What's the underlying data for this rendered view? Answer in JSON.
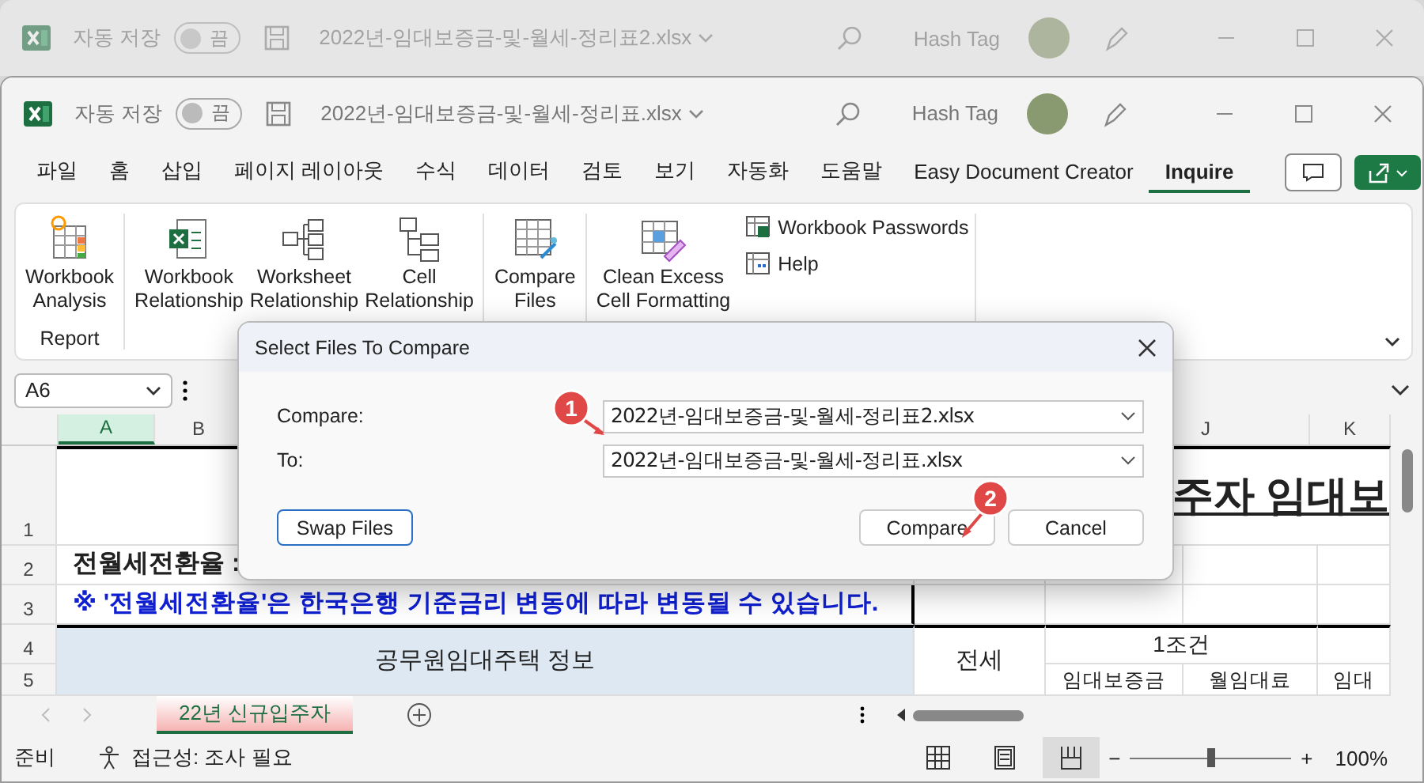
{
  "background_window": {
    "title": "2022년-임대보증금-및-월세-정리표2.xlsx",
    "autosave": {
      "label": "자동 저장",
      "state_text": "끔",
      "on": false
    },
    "user": "Hash Tag"
  },
  "window": {
    "title": "2022년-임대보증금-및-월세-정리표.xlsx",
    "autosave": {
      "label": "자동 저장",
      "state_text": "끔",
      "on": false
    },
    "user": "Hash Tag"
  },
  "menu_tabs": [
    {
      "label": "파일",
      "selected": false
    },
    {
      "label": "홈",
      "selected": false
    },
    {
      "label": "삽입",
      "selected": false
    },
    {
      "label": "페이지 레이아웃",
      "selected": false
    },
    {
      "label": "수식",
      "selected": false
    },
    {
      "label": "데이터",
      "selected": false
    },
    {
      "label": "검토",
      "selected": false
    },
    {
      "label": "보기",
      "selected": false
    },
    {
      "label": "자동화",
      "selected": false
    },
    {
      "label": "도움말",
      "selected": false
    },
    {
      "label": "Easy Document Creator",
      "selected": false
    },
    {
      "label": "Inquire",
      "selected": true
    }
  ],
  "ribbon": {
    "groups": [
      {
        "label": "Report",
        "buttons": [
          {
            "kind": "analysis",
            "label": "Workbook\nAnalysis"
          }
        ]
      },
      {
        "buttons": [
          {
            "kind": "workbook",
            "label": "Workbook\nRelationship"
          },
          {
            "kind": "worksheet",
            "label": "Worksheet\nRelationship"
          },
          {
            "kind": "cell",
            "label": "Cell\nRelationship"
          }
        ]
      },
      {
        "buttons": [
          {
            "kind": "compare",
            "label": "Compare\nFiles"
          }
        ]
      },
      {
        "buttons": [
          {
            "kind": "clean",
            "label": "Clean Excess\nCell Formatting"
          }
        ],
        "small_buttons": [
          {
            "kind": "passwords",
            "label": "Workbook Passwords"
          },
          {
            "kind": "help",
            "label": "Help"
          }
        ]
      }
    ]
  },
  "name_box": {
    "value": "A6"
  },
  "column_headers": [
    {
      "label": "A",
      "selected": true
    },
    {
      "label": "B",
      "selected": false
    },
    {
      "label": "J",
      "selected": false
    },
    {
      "label": "K",
      "selected": false
    }
  ],
  "row_headers": [
    "1",
    "2",
    "3",
    "4",
    "5"
  ],
  "sheet": {
    "title_fragment": "주자 임대보",
    "rate_label": "전월세전환율 :",
    "notice": "※ '전월세전환율'은 한국은행 기준금리 변동에 따라 변동될 수 있습니다.",
    "info_header": "공무원임대주택 정보",
    "jeonse_header": "전세",
    "condition_header": "1조건",
    "sub_headers": [
      "임대보증금",
      "월임대료",
      "임대"
    ]
  },
  "dialog": {
    "title": "Select Files To Compare",
    "fields": [
      {
        "label": "Compare:",
        "value": "2022년-임대보증금-및-월세-정리표2.xlsx"
      },
      {
        "label": "To:",
        "value": "2022년-임대보증금-및-월세-정리표.xlsx"
      }
    ],
    "left_buttons": [
      {
        "label": "Swap Files",
        "focused": true
      }
    ],
    "right_buttons": [
      {
        "label": "Compare",
        "focused": false
      },
      {
        "label": "Cancel",
        "focused": false
      }
    ]
  },
  "callouts": [
    {
      "label": "1"
    },
    {
      "label": "2"
    }
  ],
  "sheet_tabs": [
    {
      "label": "22년 신규입주자",
      "selected": true
    }
  ],
  "status_bar": {
    "ready": "준비",
    "accessibility": "접근성: 조사 필요",
    "views": [
      {
        "kind": "normal",
        "selected": false
      },
      {
        "kind": "layout",
        "selected": false
      },
      {
        "kind": "break",
        "selected": true
      }
    ],
    "zoom": {
      "minus": "−",
      "plus": "+",
      "level": 0.5,
      "reading": "100%"
    }
  }
}
